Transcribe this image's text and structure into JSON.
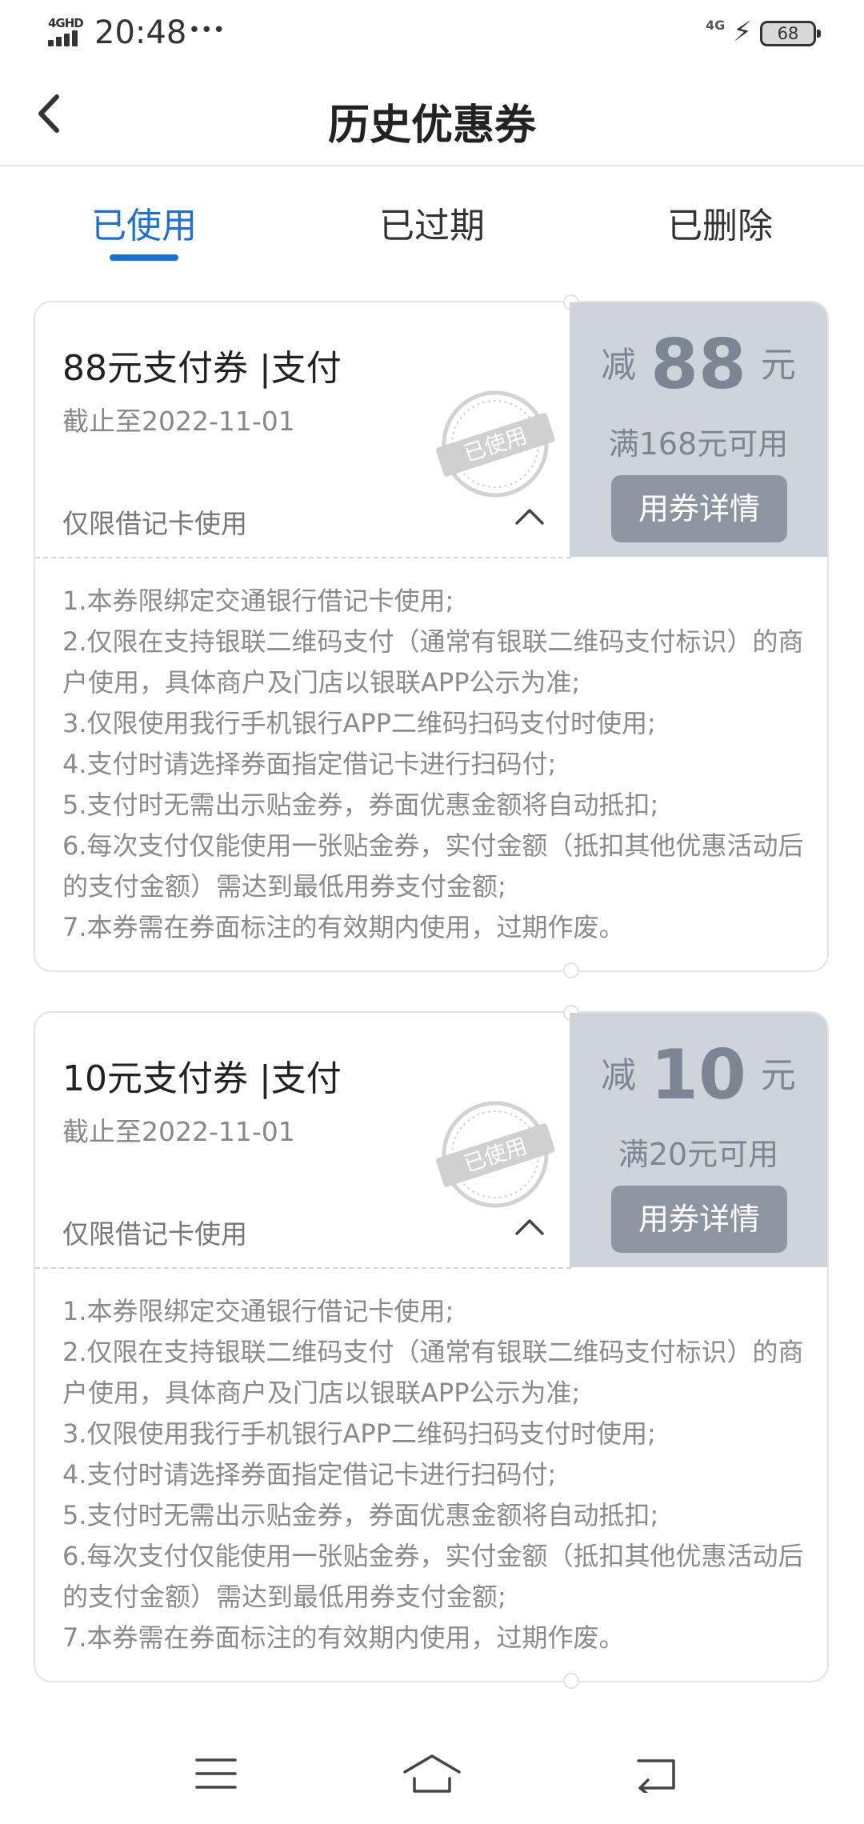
{
  "status_bar": {
    "network": "4GHD",
    "time": "20:48",
    "more": "•••",
    "network_right": "4G",
    "battery": "68"
  },
  "header": {
    "title": "历史优惠券",
    "back_icon": "chevron-left-icon"
  },
  "tabs": [
    {
      "label": "已使用",
      "active": true
    },
    {
      "label": "已过期",
      "active": false
    },
    {
      "label": "已删除",
      "active": false
    }
  ],
  "colors": {
    "accent": "#1a70d6",
    "coupon_panel": "#cfd4db",
    "detail_button": "#8d95a1"
  },
  "coupons": [
    {
      "title": "88元支付券 |支付",
      "expiry": "截止至2022-11-01",
      "limit": "仅限借记卡使用",
      "stamp": "已使用",
      "prefix": "减",
      "amount": "88",
      "unit": "元",
      "threshold": "满168元可用",
      "detail_button": "用券详情",
      "rules": [
        "1.本券限绑定交通银行借记卡使用;",
        "2.仅限在支持银联二维码支付（通常有银联二维码支付标识）的商户使用，具体商户及门店以银联APP公示为准;",
        "3.仅限使用我行手机银行APP二维码扫码支付时使用;",
        "4.支付时请选择券面指定借记卡进行扫码付;",
        "5.支付时无需出示贴金券，券面优惠金额将自动抵扣;",
        "6.每次支付仅能使用一张贴金券，实付金额（抵扣其他优惠活动后的支付金额）需达到最低用券支付金额;",
        "7.本券需在券面标注的有效期内使用，过期作废。"
      ]
    },
    {
      "title": "10元支付券 |支付",
      "expiry": "截止至2022-11-01",
      "limit": "仅限借记卡使用",
      "stamp": "已使用",
      "prefix": "减",
      "amount": "10",
      "unit": "元",
      "threshold": "满20元可用",
      "detail_button": "用券详情",
      "rules": [
        "1.本券限绑定交通银行借记卡使用;",
        "2.仅限在支持银联二维码支付（通常有银联二维码支付标识）的商户使用，具体商户及门店以银联APP公示为准;",
        "3.仅限使用我行手机银行APP二维码扫码支付时使用;",
        "4.支付时请选择券面指定借记卡进行扫码付;",
        "5.支付时无需出示贴金券，券面优惠金额将自动抵扣;",
        "6.每次支付仅能使用一张贴金券，实付金额（抵扣其他优惠活动后的支付金额）需达到最低用券支付金额;",
        "7.本券需在券面标注的有效期内使用，过期作废。"
      ]
    }
  ],
  "nav_bar": {
    "icons": [
      "menu-icon",
      "home-icon",
      "back-icon"
    ]
  }
}
